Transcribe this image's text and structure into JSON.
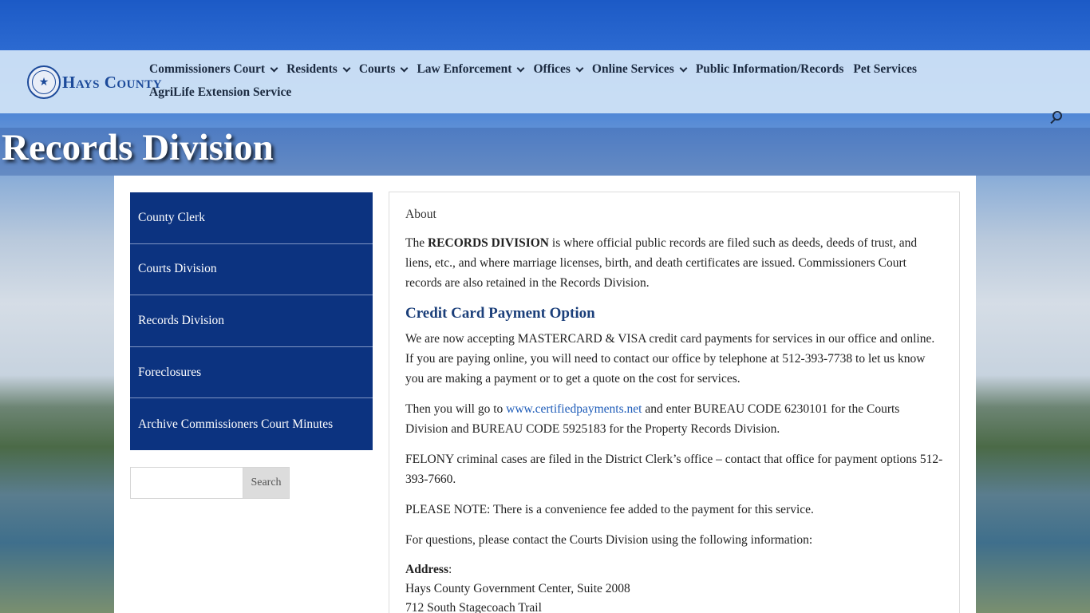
{
  "header": {
    "logo_text": "Hays County",
    "nav_row1": [
      {
        "label": "Commissioners Court",
        "dropdown": true
      },
      {
        "label": "Residents",
        "dropdown": true
      },
      {
        "label": "Courts",
        "dropdown": true
      },
      {
        "label": "Law Enforcement",
        "dropdown": true
      },
      {
        "label": "Offices",
        "dropdown": true
      },
      {
        "label": "Online Services",
        "dropdown": true
      },
      {
        "label": "Public Information/Records",
        "dropdown": false
      },
      {
        "label": "Pet Services",
        "dropdown": false
      }
    ],
    "nav_row2": [
      {
        "label": "AgriLife Extension Service",
        "dropdown": false
      }
    ],
    "search_icon": "search-icon"
  },
  "page_title": "Records Division",
  "sidebar": {
    "items": [
      {
        "label": "County Clerk"
      },
      {
        "label": "Courts Division"
      },
      {
        "label": "Records Division"
      },
      {
        "label": "Foreclosures"
      },
      {
        "label": "Archive Commissioners Court Minutes"
      }
    ],
    "search": {
      "placeholder": "",
      "button_label": "Search"
    }
  },
  "main": {
    "about_label": "About",
    "intro_prefix": "The ",
    "intro_bold": "RECORDS DIVISION",
    "intro_rest": " is where official public records are filed such as deeds, deeds of trust, and liens, etc., and where marriage licenses, birth, and death certificates are issued. Commissioners Court records are also retained in the Records Division.",
    "heading": "Credit Card Payment Option",
    "para1": "We are now accepting MASTERCARD & VISA credit card payments for services in our office and online. If you are paying online, you will need to contact our office by telephone at 512-393-7738 to let us know you are making a payment or to get a quote on the cost for services.",
    "para2_prefix": "Then you will go to ",
    "para2_link": "www.certifiedpayments.net",
    "para2_rest": " and enter BUREAU CODE 6230101 for the Courts Division and BUREAU CODE 5925183 for the Property Records Division.",
    "para3": "FELONY criminal cases are filed in the District Clerk’s office – contact that office for payment options 512-393-7660.",
    "para4": "PLEASE NOTE: There is a convenience fee added to the payment for this service.",
    "para5": "For questions, please contact the Courts Division using the following information:",
    "address_label": "Address",
    "address_colon": ":",
    "address_line1": "Hays County Government Center, Suite 2008",
    "address_line2": "712 South Stagecoach Trail"
  }
}
